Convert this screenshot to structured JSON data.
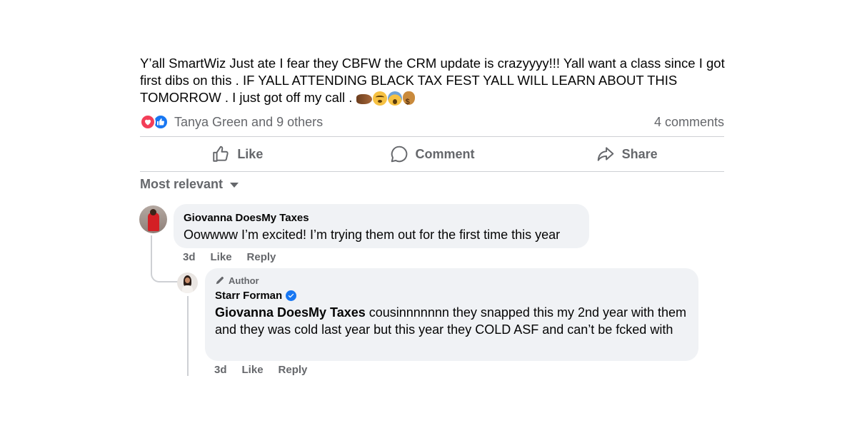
{
  "post": {
    "text": "Y’all SmartWiz Just ate I fear they CBFW the CRM update is crazyyyy!!! Yall want a class since I got first dibs on this . IF YALL ATTENDING BLACK TAX FEST YALL WILL LEARN ABOUT THIS TOMORROW . I just got off my call .",
    "emojis": [
      "hand-icon",
      "steaming-face-icon",
      "scream-face-icon",
      "money-bag-icon"
    ]
  },
  "reactions": {
    "summary": "Tanya Green and 9 others",
    "comments_count": "4 comments",
    "icons": [
      "heart-icon",
      "thumbs-up-icon"
    ]
  },
  "actions": {
    "like_label": "Like",
    "comment_label": "Comment",
    "share_label": "Share"
  },
  "sort": {
    "label": "Most relevant"
  },
  "comments": [
    {
      "author": "Giovanna DoesMy Taxes",
      "text": "Oowwww I’m excited! I’m trying them out for the first time this year",
      "time": "3d",
      "like_label": "Like",
      "reply_label": "Reply"
    },
    {
      "badge": "Author",
      "author": "Starr Forman",
      "verified": true,
      "mention": "Giovanna DoesMy Taxes",
      "text": " cousinnnnnnn they snapped this my 2nd year with them and they was cold last year but this year they COLD ASF and can’t be fcked with",
      "time": "3d",
      "like_label": "Like",
      "reply_label": "Reply"
    }
  ],
  "colors": {
    "secondary_text": "#65676b",
    "bubble": "#f0f2f5",
    "like_blue": "#1877f2",
    "love_red": "#f33e58"
  }
}
